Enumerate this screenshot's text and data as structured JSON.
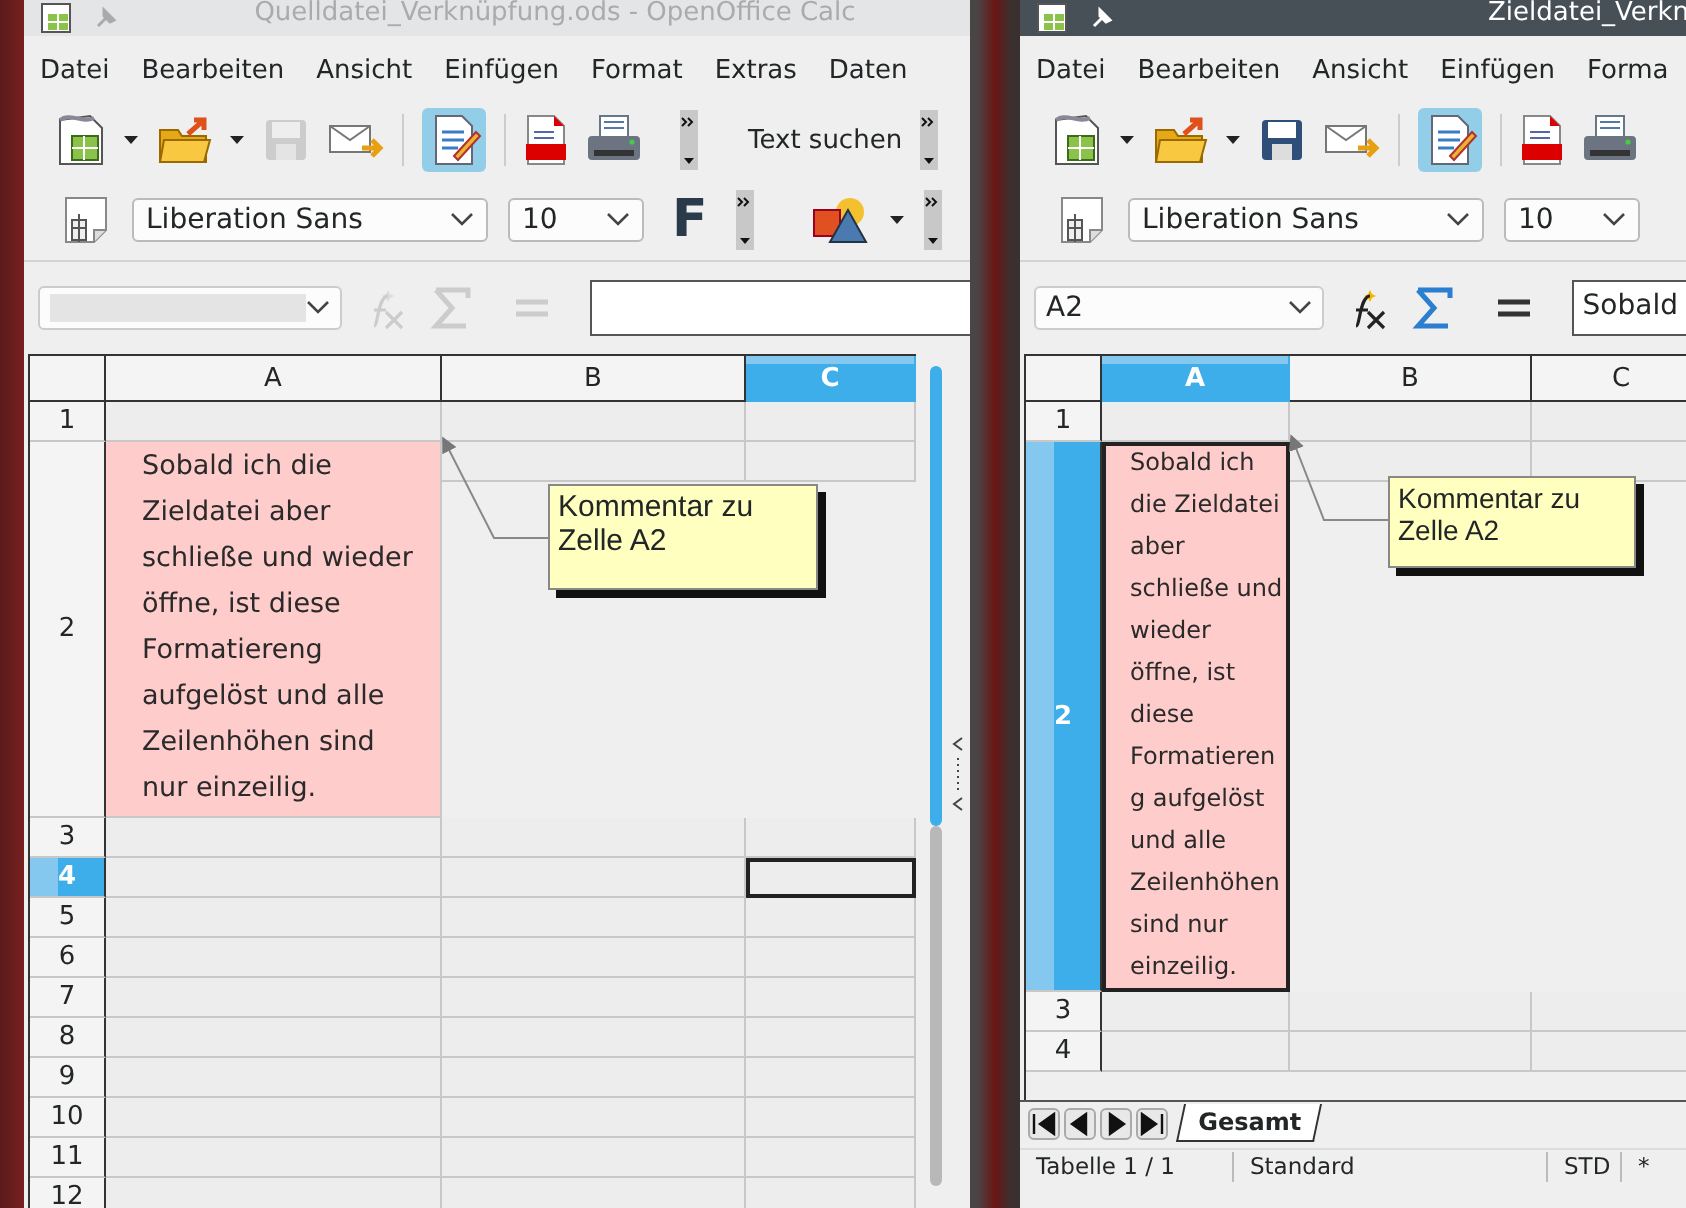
{
  "left_window": {
    "title": "Quelldatei_Verknüpfung.ods - OpenOffice Calc",
    "active": false,
    "menu": [
      "Datei",
      "Bearbeiten",
      "Ansicht",
      "Einfügen",
      "Format",
      "Extras",
      "Daten"
    ],
    "search_label": "Text suchen",
    "font_name": "Liberation Sans",
    "font_size": "10",
    "bold_label": "F",
    "formula_bar": {
      "disabled": true
    },
    "columns": [
      {
        "label": "A",
        "selected": false
      },
      {
        "label": "B",
        "selected": false
      },
      {
        "label": "C",
        "selected": true
      }
    ],
    "rows": [
      {
        "label": "1",
        "selected": false
      },
      {
        "label": "2",
        "selected": false,
        "cells": [
          "Sobald ich die Zieldatei aber schließe und wieder öffne, ist diese Formatiereng aufgelöst und alle Zeilenhöhen sind nur einzeilig."
        ]
      },
      {
        "label": "3",
        "selected": false
      },
      {
        "label": "4",
        "selected": true
      },
      {
        "label": "5",
        "selected": false
      },
      {
        "label": "6",
        "selected": false
      },
      {
        "label": "7",
        "selected": false
      },
      {
        "label": "8",
        "selected": false
      },
      {
        "label": "9",
        "selected": false
      },
      {
        "label": "10",
        "selected": false
      },
      {
        "label": "11",
        "selected": false
      },
      {
        "label": "12",
        "selected": false
      }
    ],
    "comment": "Kommentar zu Zelle A2"
  },
  "right_window": {
    "title": "Zieldatei_Verkn",
    "active": true,
    "menu": [
      "Datei",
      "Bearbeiten",
      "Ansicht",
      "Einfügen",
      "Forma"
    ],
    "font_name": "Liberation Sans",
    "font_size": "10",
    "formula_bar": {
      "disabled": false,
      "name_box": "A2",
      "value": "Sobald"
    },
    "columns": [
      {
        "label": "A",
        "selected": true
      },
      {
        "label": "B",
        "selected": false
      },
      {
        "label": "C",
        "selected": false
      }
    ],
    "rows": [
      {
        "label": "1",
        "selected": false
      },
      {
        "label": "2",
        "selected": true,
        "cells": [
          "Sobald ich die Zieldatei aber schließe und wieder öffne, ist diese Formatiereng aufgelöst und alle Zeilenhöhen sind nur einzeilig."
        ]
      },
      {
        "label": "3",
        "selected": false
      },
      {
        "label": "4",
        "selected": false
      }
    ],
    "comment": "Kommentar zu Zelle A2",
    "sheet_tabs": [
      {
        "label": "Gesamt",
        "selected": true
      }
    ],
    "status_bar": [
      "Tabelle 1 / 1",
      "Standard",
      "STD",
      "*"
    ]
  }
}
